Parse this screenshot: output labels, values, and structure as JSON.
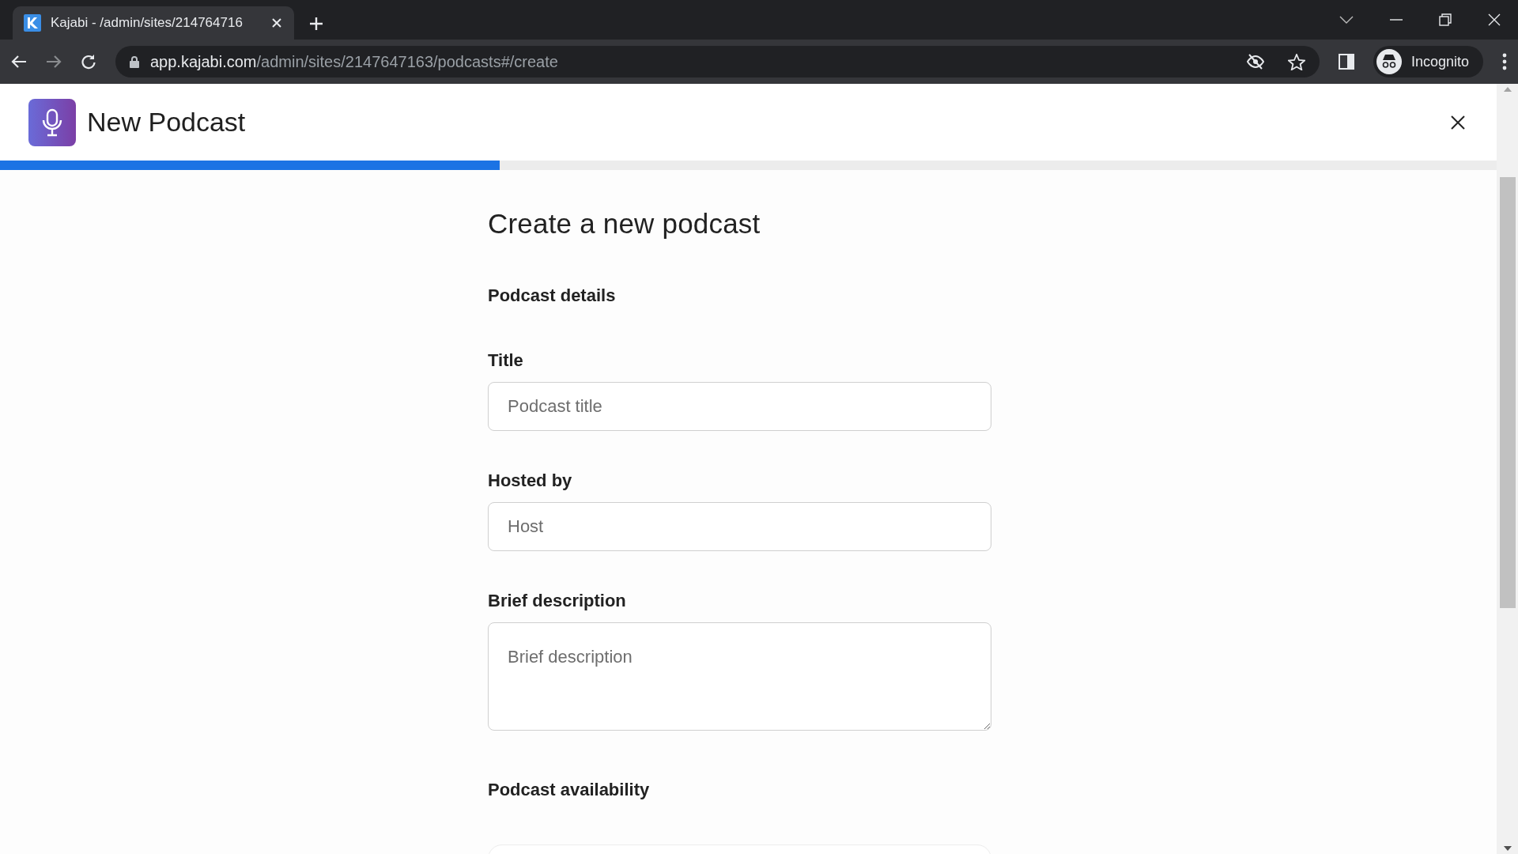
{
  "browser": {
    "tab": {
      "title": "Kajabi - /admin/sites/214764716",
      "selected": true
    },
    "url": {
      "host": "app.kajabi.com",
      "path": "/admin/sites/2147647163/podcasts#/create"
    },
    "profile": "Incognito"
  },
  "header": {
    "title": "New Podcast"
  },
  "progress": {
    "level": 0.334
  },
  "form": {
    "heading": "Create a new podcast",
    "sections": [
      {
        "title": "Podcast details",
        "fields": [
          {
            "kind": "input",
            "label": "Title",
            "placeholder": "Podcast title"
          },
          {
            "kind": "input",
            "label": "Hosted by",
            "placeholder": "Host"
          },
          {
            "kind": "textarea",
            "label": "Brief description",
            "placeholder": "Brief description"
          }
        ]
      },
      {
        "title": "Podcast availability"
      }
    ]
  }
}
